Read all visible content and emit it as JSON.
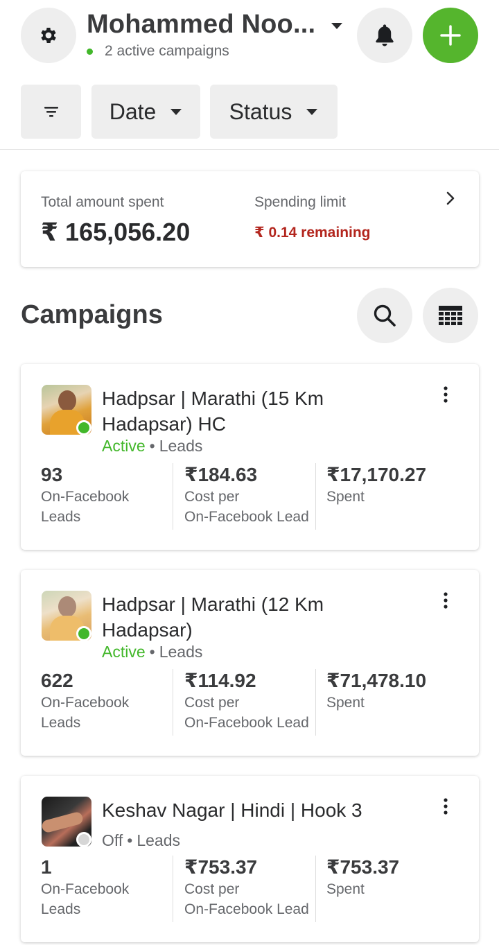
{
  "header": {
    "account_name": "Mohammed Noo...",
    "status": "2 active campaigns",
    "icons": {
      "settings": "gear-icon",
      "notifications": "bell-icon",
      "create": "plus-icon",
      "account_dropdown": "caret-down-icon"
    }
  },
  "filters": {
    "filter_icon": "filter-lines-icon",
    "date_label": "Date",
    "status_label": "Status"
  },
  "summary": {
    "total_label": "Total amount spent",
    "total_value": "₹ 165,056.20",
    "limit_label": "Spending limit",
    "limit_remaining": "₹ 0.14 remaining"
  },
  "campaigns_section": {
    "title": "Campaigns",
    "icons": {
      "search": "search-icon",
      "table_view": "table-icon"
    }
  },
  "campaigns": [
    {
      "name": "Hadpsar | Marathi  (15 Km Hadapsar) HC",
      "state": "Active",
      "objective": "Leads",
      "metrics": [
        {
          "value": "93",
          "label1": "On-Facebook",
          "label2": "Leads"
        },
        {
          "value": "₹184.63",
          "label1": "Cost per",
          "label2": "On-Facebook Lead"
        },
        {
          "value": "₹17,170.27",
          "label1": "Spent",
          "label2": ""
        }
      ]
    },
    {
      "name": "Hadpsar | Marathi  (12 Km Hadapsar)",
      "state": "Active",
      "objective": "Leads",
      "metrics": [
        {
          "value": "622",
          "label1": "On-Facebook",
          "label2": "Leads"
        },
        {
          "value": "₹114.92",
          "label1": "Cost per",
          "label2": "On-Facebook Lead"
        },
        {
          "value": "₹71,478.10",
          "label1": "Spent",
          "label2": ""
        }
      ]
    },
    {
      "name": "Keshav Nagar | Hindi | Hook 3",
      "state": "Off",
      "objective": "Leads",
      "metrics": [
        {
          "value": "1",
          "label1": "On-Facebook",
          "label2": "Leads"
        },
        {
          "value": "₹753.37",
          "label1": "Cost per",
          "label2": "On-Facebook Lead"
        },
        {
          "value": "₹753.37",
          "label1": "Spent",
          "label2": ""
        }
      ]
    }
  ],
  "colors": {
    "accent_green": "#55b52d",
    "active_green": "#42b72a",
    "warning_red": "#b3261e"
  }
}
